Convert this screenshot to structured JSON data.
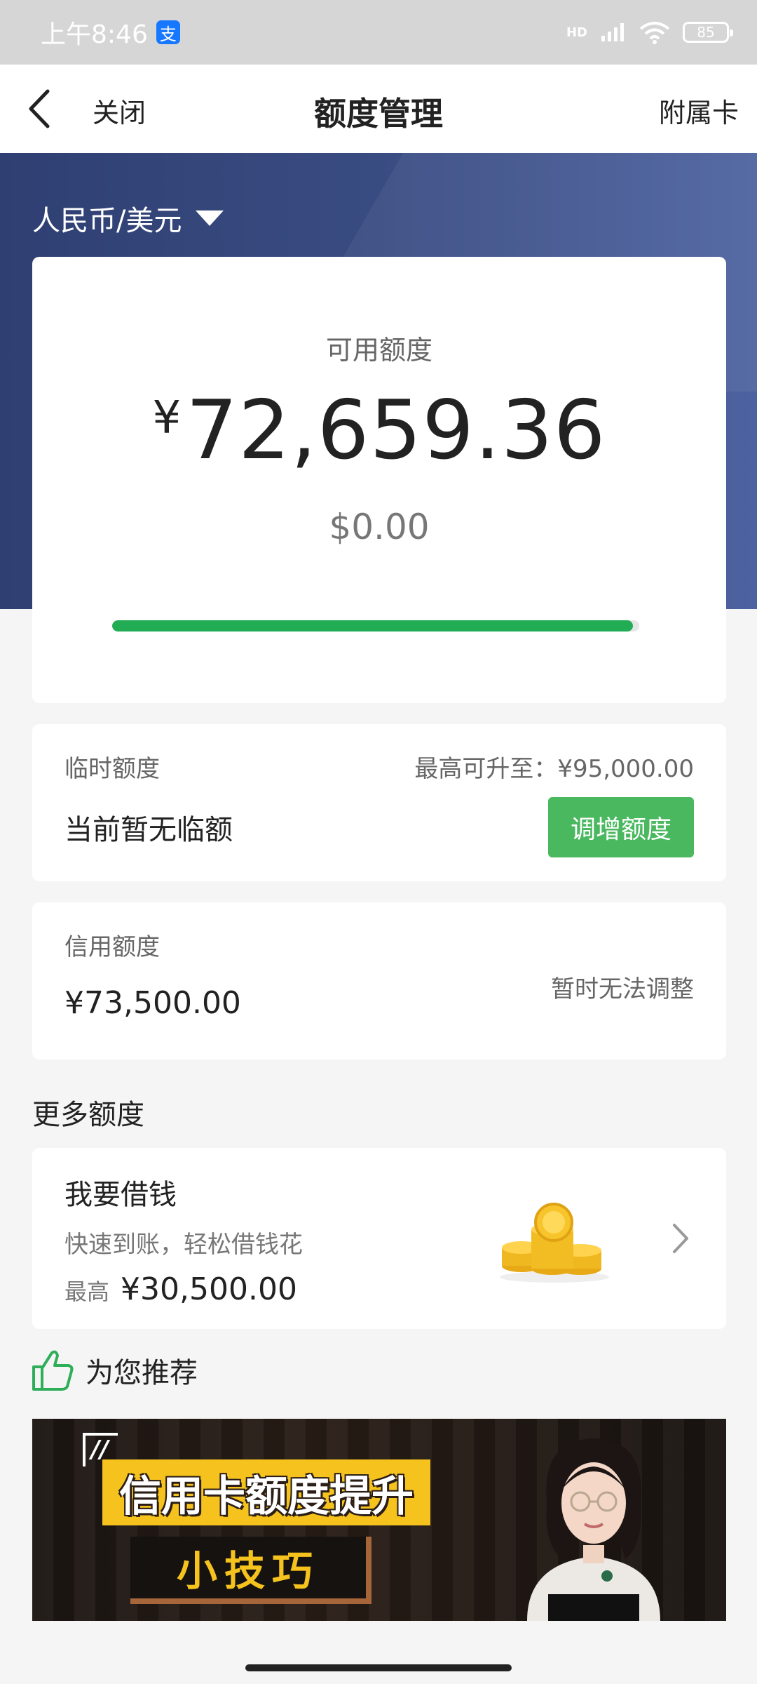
{
  "status_bar": {
    "time": "上午8:46",
    "app_badge": "支",
    "network": "HD",
    "battery": "85"
  },
  "nav": {
    "close_label": "关闭",
    "title": "额度管理",
    "right_label": "附属卡"
  },
  "currency_selector": {
    "label": "人民币/美元"
  },
  "available": {
    "label": "可用额度",
    "cny_symbol": "¥",
    "cny_amount": "72,659.36",
    "usd_amount": "$0.00",
    "usage_fraction": 0.988
  },
  "temporary": {
    "label": "临时额度",
    "max_label": "最高可升至：¥95,000.00",
    "status": "当前暂无临额",
    "button_label": "调增额度"
  },
  "credit": {
    "label": "信用额度",
    "value": "¥73,500.00",
    "note": "暂时无法调整"
  },
  "more": {
    "title": "更多额度",
    "loan": {
      "title": "我要借钱",
      "subtitle": "快速到账，轻松借钱花",
      "max_label": "最高",
      "max_value": "¥30,500.00"
    }
  },
  "recommend": {
    "title": "为您推荐",
    "banner": {
      "line1": "信用卡额度提升",
      "line2": "小技巧"
    }
  },
  "colors": {
    "header_blue": "#394c82",
    "accent_green": "#22ad55",
    "button_green": "#49b85f",
    "banner_yellow": "#f6c21d"
  }
}
